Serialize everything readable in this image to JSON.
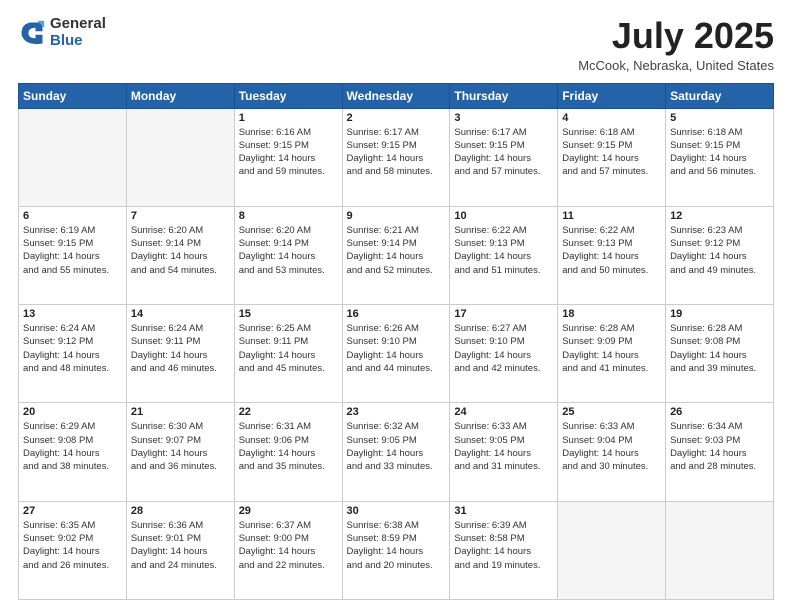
{
  "header": {
    "logo_general": "General",
    "logo_blue": "Blue",
    "month_title": "July 2025",
    "location": "McCook, Nebraska, United States"
  },
  "weekdays": [
    "Sunday",
    "Monday",
    "Tuesday",
    "Wednesday",
    "Thursday",
    "Friday",
    "Saturday"
  ],
  "weeks": [
    [
      {
        "day": "",
        "sunrise": "",
        "sunset": "",
        "daylight": ""
      },
      {
        "day": "",
        "sunrise": "",
        "sunset": "",
        "daylight": ""
      },
      {
        "day": "1",
        "sunrise": "Sunrise: 6:16 AM",
        "sunset": "Sunset: 9:15 PM",
        "daylight": "Daylight: 14 hours and 59 minutes."
      },
      {
        "day": "2",
        "sunrise": "Sunrise: 6:17 AM",
        "sunset": "Sunset: 9:15 PM",
        "daylight": "Daylight: 14 hours and 58 minutes."
      },
      {
        "day": "3",
        "sunrise": "Sunrise: 6:17 AM",
        "sunset": "Sunset: 9:15 PM",
        "daylight": "Daylight: 14 hours and 57 minutes."
      },
      {
        "day": "4",
        "sunrise": "Sunrise: 6:18 AM",
        "sunset": "Sunset: 9:15 PM",
        "daylight": "Daylight: 14 hours and 57 minutes."
      },
      {
        "day": "5",
        "sunrise": "Sunrise: 6:18 AM",
        "sunset": "Sunset: 9:15 PM",
        "daylight": "Daylight: 14 hours and 56 minutes."
      }
    ],
    [
      {
        "day": "6",
        "sunrise": "Sunrise: 6:19 AM",
        "sunset": "Sunset: 9:15 PM",
        "daylight": "Daylight: 14 hours and 55 minutes."
      },
      {
        "day": "7",
        "sunrise": "Sunrise: 6:20 AM",
        "sunset": "Sunset: 9:14 PM",
        "daylight": "Daylight: 14 hours and 54 minutes."
      },
      {
        "day": "8",
        "sunrise": "Sunrise: 6:20 AM",
        "sunset": "Sunset: 9:14 PM",
        "daylight": "Daylight: 14 hours and 53 minutes."
      },
      {
        "day": "9",
        "sunrise": "Sunrise: 6:21 AM",
        "sunset": "Sunset: 9:14 PM",
        "daylight": "Daylight: 14 hours and 52 minutes."
      },
      {
        "day": "10",
        "sunrise": "Sunrise: 6:22 AM",
        "sunset": "Sunset: 9:13 PM",
        "daylight": "Daylight: 14 hours and 51 minutes."
      },
      {
        "day": "11",
        "sunrise": "Sunrise: 6:22 AM",
        "sunset": "Sunset: 9:13 PM",
        "daylight": "Daylight: 14 hours and 50 minutes."
      },
      {
        "day": "12",
        "sunrise": "Sunrise: 6:23 AM",
        "sunset": "Sunset: 9:12 PM",
        "daylight": "Daylight: 14 hours and 49 minutes."
      }
    ],
    [
      {
        "day": "13",
        "sunrise": "Sunrise: 6:24 AM",
        "sunset": "Sunset: 9:12 PM",
        "daylight": "Daylight: 14 hours and 48 minutes."
      },
      {
        "day": "14",
        "sunrise": "Sunrise: 6:24 AM",
        "sunset": "Sunset: 9:11 PM",
        "daylight": "Daylight: 14 hours and 46 minutes."
      },
      {
        "day": "15",
        "sunrise": "Sunrise: 6:25 AM",
        "sunset": "Sunset: 9:11 PM",
        "daylight": "Daylight: 14 hours and 45 minutes."
      },
      {
        "day": "16",
        "sunrise": "Sunrise: 6:26 AM",
        "sunset": "Sunset: 9:10 PM",
        "daylight": "Daylight: 14 hours and 44 minutes."
      },
      {
        "day": "17",
        "sunrise": "Sunrise: 6:27 AM",
        "sunset": "Sunset: 9:10 PM",
        "daylight": "Daylight: 14 hours and 42 minutes."
      },
      {
        "day": "18",
        "sunrise": "Sunrise: 6:28 AM",
        "sunset": "Sunset: 9:09 PM",
        "daylight": "Daylight: 14 hours and 41 minutes."
      },
      {
        "day": "19",
        "sunrise": "Sunrise: 6:28 AM",
        "sunset": "Sunset: 9:08 PM",
        "daylight": "Daylight: 14 hours and 39 minutes."
      }
    ],
    [
      {
        "day": "20",
        "sunrise": "Sunrise: 6:29 AM",
        "sunset": "Sunset: 9:08 PM",
        "daylight": "Daylight: 14 hours and 38 minutes."
      },
      {
        "day": "21",
        "sunrise": "Sunrise: 6:30 AM",
        "sunset": "Sunset: 9:07 PM",
        "daylight": "Daylight: 14 hours and 36 minutes."
      },
      {
        "day": "22",
        "sunrise": "Sunrise: 6:31 AM",
        "sunset": "Sunset: 9:06 PM",
        "daylight": "Daylight: 14 hours and 35 minutes."
      },
      {
        "day": "23",
        "sunrise": "Sunrise: 6:32 AM",
        "sunset": "Sunset: 9:05 PM",
        "daylight": "Daylight: 14 hours and 33 minutes."
      },
      {
        "day": "24",
        "sunrise": "Sunrise: 6:33 AM",
        "sunset": "Sunset: 9:05 PM",
        "daylight": "Daylight: 14 hours and 31 minutes."
      },
      {
        "day": "25",
        "sunrise": "Sunrise: 6:33 AM",
        "sunset": "Sunset: 9:04 PM",
        "daylight": "Daylight: 14 hours and 30 minutes."
      },
      {
        "day": "26",
        "sunrise": "Sunrise: 6:34 AM",
        "sunset": "Sunset: 9:03 PM",
        "daylight": "Daylight: 14 hours and 28 minutes."
      }
    ],
    [
      {
        "day": "27",
        "sunrise": "Sunrise: 6:35 AM",
        "sunset": "Sunset: 9:02 PM",
        "daylight": "Daylight: 14 hours and 26 minutes."
      },
      {
        "day": "28",
        "sunrise": "Sunrise: 6:36 AM",
        "sunset": "Sunset: 9:01 PM",
        "daylight": "Daylight: 14 hours and 24 minutes."
      },
      {
        "day": "29",
        "sunrise": "Sunrise: 6:37 AM",
        "sunset": "Sunset: 9:00 PM",
        "daylight": "Daylight: 14 hours and 22 minutes."
      },
      {
        "day": "30",
        "sunrise": "Sunrise: 6:38 AM",
        "sunset": "Sunset: 8:59 PM",
        "daylight": "Daylight: 14 hours and 20 minutes."
      },
      {
        "day": "31",
        "sunrise": "Sunrise: 6:39 AM",
        "sunset": "Sunset: 8:58 PM",
        "daylight": "Daylight: 14 hours and 19 minutes."
      },
      {
        "day": "",
        "sunrise": "",
        "sunset": "",
        "daylight": ""
      },
      {
        "day": "",
        "sunrise": "",
        "sunset": "",
        "daylight": ""
      }
    ]
  ]
}
